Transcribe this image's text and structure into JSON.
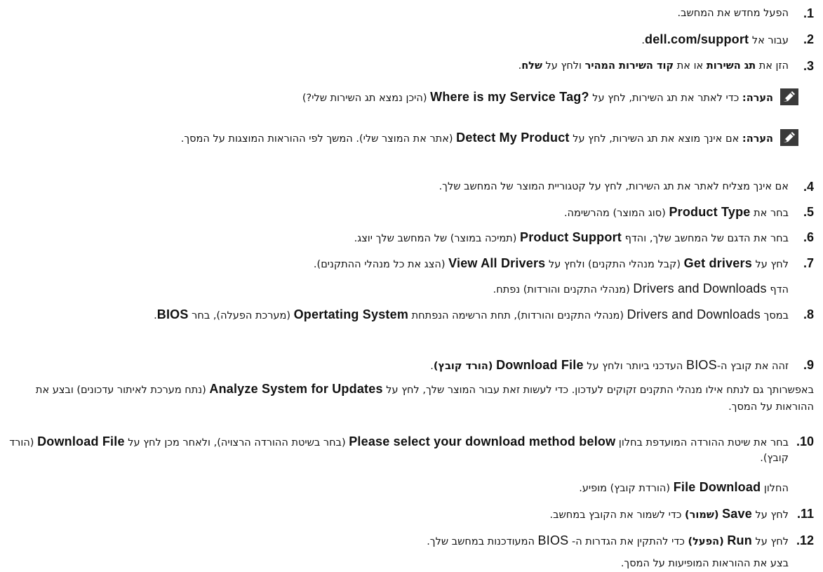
{
  "steps": [
    {
      "n": "1.",
      "parts": [
        {
          "t": "הפעל מחדש את המחשב."
        }
      ]
    },
    {
      "n": "2.",
      "parts": [
        {
          "t": "עבור אל "
        },
        {
          "t": "dell.com/support",
          "s": "lb"
        },
        {
          "t": "."
        }
      ]
    },
    {
      "n": "3.",
      "parts": [
        {
          "t": "הזן את "
        },
        {
          "t": "תג השירות",
          "s": "b"
        },
        {
          "t": " או את "
        },
        {
          "t": "קוד השירות המהיר",
          "s": "b"
        },
        {
          "t": " ולחץ על "
        },
        {
          "t": "שלח",
          "s": "b"
        },
        {
          "t": "."
        }
      ]
    },
    {
      "n": "4.",
      "parts": [
        {
          "t": "אם אינך מצליח לאתר את תג השירות, לחץ על קטגוריית המוצר של המחשב שלך."
        }
      ]
    },
    {
      "n": "5.",
      "parts": [
        {
          "t": "בחר את "
        },
        {
          "t": "Product Type",
          "s": "lb"
        },
        {
          "t": " (סוג המוצר) מהרשימה."
        }
      ]
    },
    {
      "n": "6.",
      "parts": [
        {
          "t": "בחר את הדגם של המחשב שלך, והדף "
        },
        {
          "t": "Product Support",
          "s": "lb"
        },
        {
          "t": " (תמיכה במוצר) של המחשב שלך יוצג."
        }
      ]
    },
    {
      "n": "7.",
      "parts": [
        {
          "t": "לחץ על "
        },
        {
          "t": "Get drivers",
          "s": "lb"
        },
        {
          "t": " (קבל מנהלי התקנים) ולחץ על "
        },
        {
          "t": "View All Drivers",
          "s": "lb"
        },
        {
          "t": " (הצג את כל מנהלי ההתקנים)."
        }
      ]
    },
    {
      "n": "",
      "parts": [
        {
          "t": "הדף "
        },
        {
          "t": "Drivers and Downloads",
          "s": "l"
        },
        {
          "t": " (מנהלי התקנים והורדות) נפתח."
        }
      ]
    },
    {
      "n": "8.",
      "parts": [
        {
          "t": "במסך "
        },
        {
          "t": "Drivers and Downloads",
          "s": "l"
        },
        {
          "t": " (מנהלי התקנים והורדות), תחת הרשימה הנפתחת "
        },
        {
          "t": "Opertating System",
          "s": "lb"
        },
        {
          "t": " (מערכת הפעלה), בחר "
        },
        {
          "t": "BIOS",
          "s": "lb"
        },
        {
          "t": "."
        }
      ]
    },
    {
      "n": "9.",
      "parts": [
        {
          "t": "זהה את קובץ ה-"
        },
        {
          "t": "BIOS",
          "s": "l"
        },
        {
          "t": " העדכני ביותר ולחץ על "
        },
        {
          "t": "Download File",
          "s": "lb"
        },
        {
          "t": " "
        },
        {
          "t": "(הורד קובץ)",
          "s": "b"
        },
        {
          "t": "."
        }
      ]
    },
    {
      "n": "10.",
      "parts": [
        {
          "t": "בחר את שיטת ההורדה המועדפת בחלון "
        },
        {
          "t": "Please select your download method below",
          "s": "lb"
        },
        {
          "t": " (בחר בשיטת ההורדה הרצויה), ולאחר מכן לחץ על "
        },
        {
          "t": "Download File",
          "s": "lb"
        },
        {
          "t": " (הורד קובץ)."
        }
      ]
    },
    {
      "n": "",
      "parts": [
        {
          "t": "החלון "
        },
        {
          "t": "File Download",
          "s": "lb"
        },
        {
          "t": " (הורדת קובץ) מופיע."
        }
      ]
    },
    {
      "n": "11.",
      "parts": [
        {
          "t": "לחץ על "
        },
        {
          "t": "Save",
          "s": "lb"
        },
        {
          "t": " "
        },
        {
          "t": "(שמור)",
          "s": "b"
        },
        {
          "t": " כדי לשמור את הקובץ במחשב."
        }
      ]
    },
    {
      "n": "12.",
      "parts": [
        {
          "t": "לחץ על "
        },
        {
          "t": "Run",
          "s": "lb"
        },
        {
          "t": " "
        },
        {
          "t": "(הפעל)",
          "s": "b"
        },
        {
          "t": " כדי להתקין את הגדרות ה- "
        },
        {
          "t": "BIOS",
          "s": "l"
        },
        {
          "t": " המעודכנות במחשב שלך."
        }
      ]
    },
    {
      "n": "",
      "parts": [
        {
          "t": "בצע את ההוראות המופיעות על המסך."
        }
      ]
    }
  ],
  "notes": [
    {
      "parts": [
        {
          "t": "הערה:",
          "s": "b"
        },
        {
          "t": " כדי לאתר את תג השירות, לחץ על "
        },
        {
          "t": "Where is my Service Tag?",
          "s": "lb"
        },
        {
          "t": " (היכן נמצא תג השירות שלי?)"
        }
      ]
    },
    {
      "parts": [
        {
          "t": "הערה:",
          "s": "b"
        },
        {
          "t": " אם אינך מוצא את תג השירות, לחץ על "
        },
        {
          "t": "Detect My Product",
          "s": "lb"
        },
        {
          "t": " (אתר את המוצר שלי). המשך לפי ההוראות המוצגות על המסך."
        }
      ]
    }
  ],
  "para": {
    "parts": [
      {
        "t": "באפשרותך גם לנתח אילו מנהלי התקנים זקוקים לעדכון. כדי לעשות זאת עבור המוצר שלך, לחץ על "
      },
      {
        "t": "Analyze System for Updates",
        "s": "lb"
      },
      {
        "t": " (נתח מערכת לאיתור עדכונים) ובצע את ההוראות על המסך."
      }
    ]
  }
}
